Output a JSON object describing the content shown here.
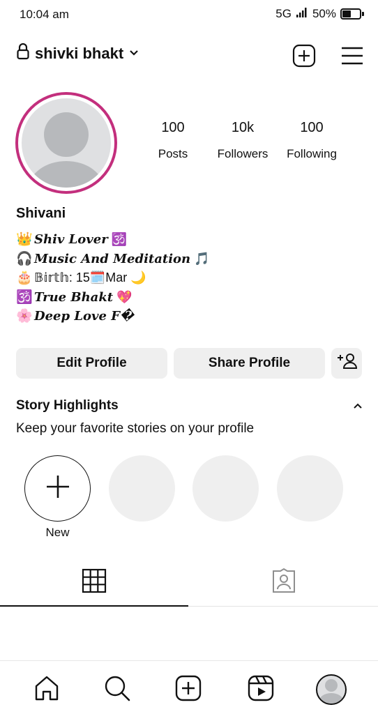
{
  "status_bar": {
    "time": "10:04 am",
    "network": "5G",
    "battery": "50%"
  },
  "header": {
    "username": "shivki bhakt",
    "icons": [
      "lock-icon",
      "chevron-down-icon",
      "new-post-icon",
      "menu-icon"
    ]
  },
  "profile": {
    "stats": [
      {
        "value": "100",
        "label": "Posts"
      },
      {
        "value": "10k",
        "label": "Followers"
      },
      {
        "value": "100",
        "label": "Following"
      }
    ],
    "display_name": "Shivani",
    "bio": [
      {
        "emoji": "👑",
        "text": "Shiv Lover",
        "suffix": "🕉️",
        "fancy": true
      },
      {
        "emoji": "🎧",
        "text": "Music And Meditation",
        "suffix": "🎵",
        "fancy": true
      },
      {
        "emoji": "🎂",
        "text": "𝔹𝕚𝕣𝕥𝕙: 15🗓️Mar",
        "suffix": "🌙",
        "fancy": false
      },
      {
        "emoji": "🕉️",
        "text": "True Bhakt",
        "suffix": "💖",
        "fancy": true
      },
      {
        "emoji": "🌸",
        "text": "Deep Love F�",
        "suffix": "",
        "fancy": true
      }
    ]
  },
  "actions": {
    "edit_profile": "Edit Profile",
    "share_profile": "Share Profile"
  },
  "highlights": {
    "title": "Story Highlights",
    "subtitle": "Keep your favorite stories on your profile",
    "new_label": "New"
  },
  "tabs": [
    "grid-icon",
    "tagged-icon"
  ],
  "bottom_nav": [
    "home-icon",
    "search-icon",
    "create-icon",
    "reels-icon",
    "profile-avatar"
  ],
  "colors": {
    "story_ring": "#c32f7d",
    "button_bg": "#efefef",
    "placeholder": "#dfe0e2"
  }
}
